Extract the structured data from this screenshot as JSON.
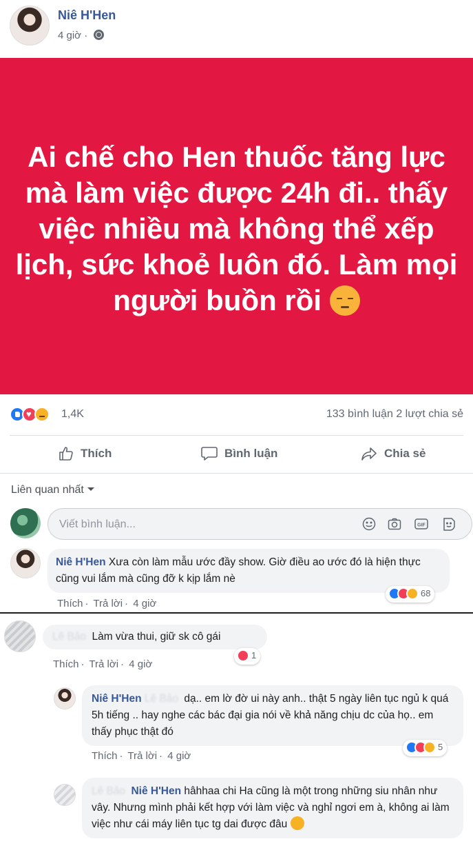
{
  "post": {
    "author": "Niê H'Hen",
    "time": "4 giờ",
    "privacy_icon": "globe-icon",
    "banner_color": "#e21742",
    "text": "Ai chế cho Hen thuốc tăng lực mà làm việc được 24h đi.. thấy việc nhiều mà không thể xếp lịch, sức khoẻ luôn đó. Làm mọi người buồn rồi",
    "reaction_count": "1,4K",
    "comment_count": "133 bình luận",
    "share_count": "2 lượt chia sẻ"
  },
  "actions": {
    "like": "Thích",
    "comment": "Bình luận",
    "share": "Chia sẻ"
  },
  "sort_label": "Liên quan nhất",
  "composer": {
    "placeholder": "Viết bình luận..."
  },
  "comments": [
    {
      "author": "Niê H'Hen",
      "text": "Xưa còn làm mẫu ước đầy show. Giờ điều ao ước đó là hiện thực cũng vui lắm mà cũng đỡ k kịp lắm nè",
      "like": "Thích",
      "reply": "Trả lời",
      "time": "4 giờ",
      "reactions": "68"
    },
    {
      "author_blurred": "Lê Bảo",
      "text": "Làm vừa thui, giữ sk cô gái",
      "like": "Thích",
      "reply": "Trả lời",
      "time": "4 giờ",
      "reactions": "1"
    },
    {
      "author": "Niê H'Hen",
      "mention_blurred": "Lê Bảo",
      "text": "dạ.. em lờ đờ ui này anh.. thật 5 ngày liên tục ngủ k quá 5h tiếng .. hay nghe các bác đại gia nói về khả năng chịu dc của họ.. em thấy phục thật đó",
      "like": "Thích",
      "reply": "Trả lời",
      "time": "4 giờ",
      "reactions": "5"
    },
    {
      "author_blurred": "Lê Bảo",
      "mention": "Niê H'Hen",
      "text": "hâhhaa chi Ha cũng là một trong những siu nhân như vây. Nhưng mình phải kết hợp với làm việc và nghỉ ngơi em à, không ai làm việc như cái máy liên tục tg dai được đâu"
    }
  ]
}
